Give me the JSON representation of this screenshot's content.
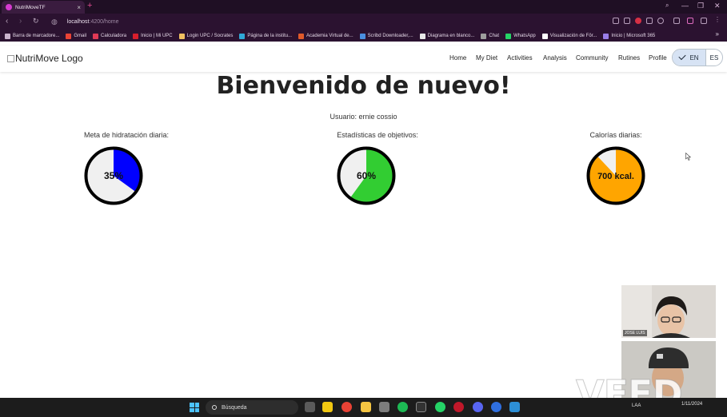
{
  "browser": {
    "tab_title": "NutriMoveTF",
    "tab_close": "×",
    "new_tab": "+",
    "url_host": "localhost",
    "url_rest": ":4200/home",
    "window_controls": [
      "—",
      "❐",
      "✕"
    ],
    "bookmarks": [
      {
        "label": "Barra de marcadore...",
        "color": "#c9b3cc"
      },
      {
        "label": "Gmail",
        "color": "#ea4335"
      },
      {
        "label": "Calculadora",
        "color": "#e03a56"
      },
      {
        "label": "Inicio | Mi UPC",
        "color": "#d81e2c"
      },
      {
        "label": "Login UPC / Socrates",
        "color": "#f0c060"
      },
      {
        "label": "Página de la institu...",
        "color": "#2fa8d6"
      },
      {
        "label": "Academia Virtual de...",
        "color": "#e05a2a"
      },
      {
        "label": "Scribd Downloader,...",
        "color": "#4a8fe0"
      },
      {
        "label": "Diagrama en blanco...",
        "color": "#e8e8e8"
      },
      {
        "label": "Chat",
        "color": "#9d9d9d"
      },
      {
        "label": "WhatsApp",
        "color": "#25d366"
      },
      {
        "label": "Visualización de För...",
        "color": "#ffffff"
      },
      {
        "label": "Inicio | Microsoft 365",
        "color": "#9a7ee8"
      }
    ],
    "bookmarks_more": "»"
  },
  "app": {
    "logo_alt": "NutriMove Logo",
    "nav": [
      "Home",
      "My Diet",
      "Activities",
      "Analysis",
      "Community",
      "Rutines",
      "Profile"
    ],
    "lang_en": "EN",
    "lang_es": "ES",
    "heading": "Bienvenido de nuevo!",
    "user_line": "Usuario: ernie cossio",
    "stats": [
      {
        "label": "Meta de hidratación diaria:",
        "value_text": "35%",
        "fraction": 0.35,
        "color": "#0000ff"
      },
      {
        "label": "Estadísticas de objetivos:",
        "value_text": "60%",
        "fraction": 0.6,
        "color": "#32cd32"
      },
      {
        "label": "Calorías diarias:",
        "value_text": "700 kcal.",
        "fraction": 0.88,
        "color": "#ffa500"
      }
    ]
  },
  "video": {
    "participant1": "JOSE LUIS"
  },
  "watermark": "VEED",
  "taskbar": {
    "search_placeholder": "Búsqueda",
    "lang": "LAA",
    "date": "1/11/2024"
  }
}
